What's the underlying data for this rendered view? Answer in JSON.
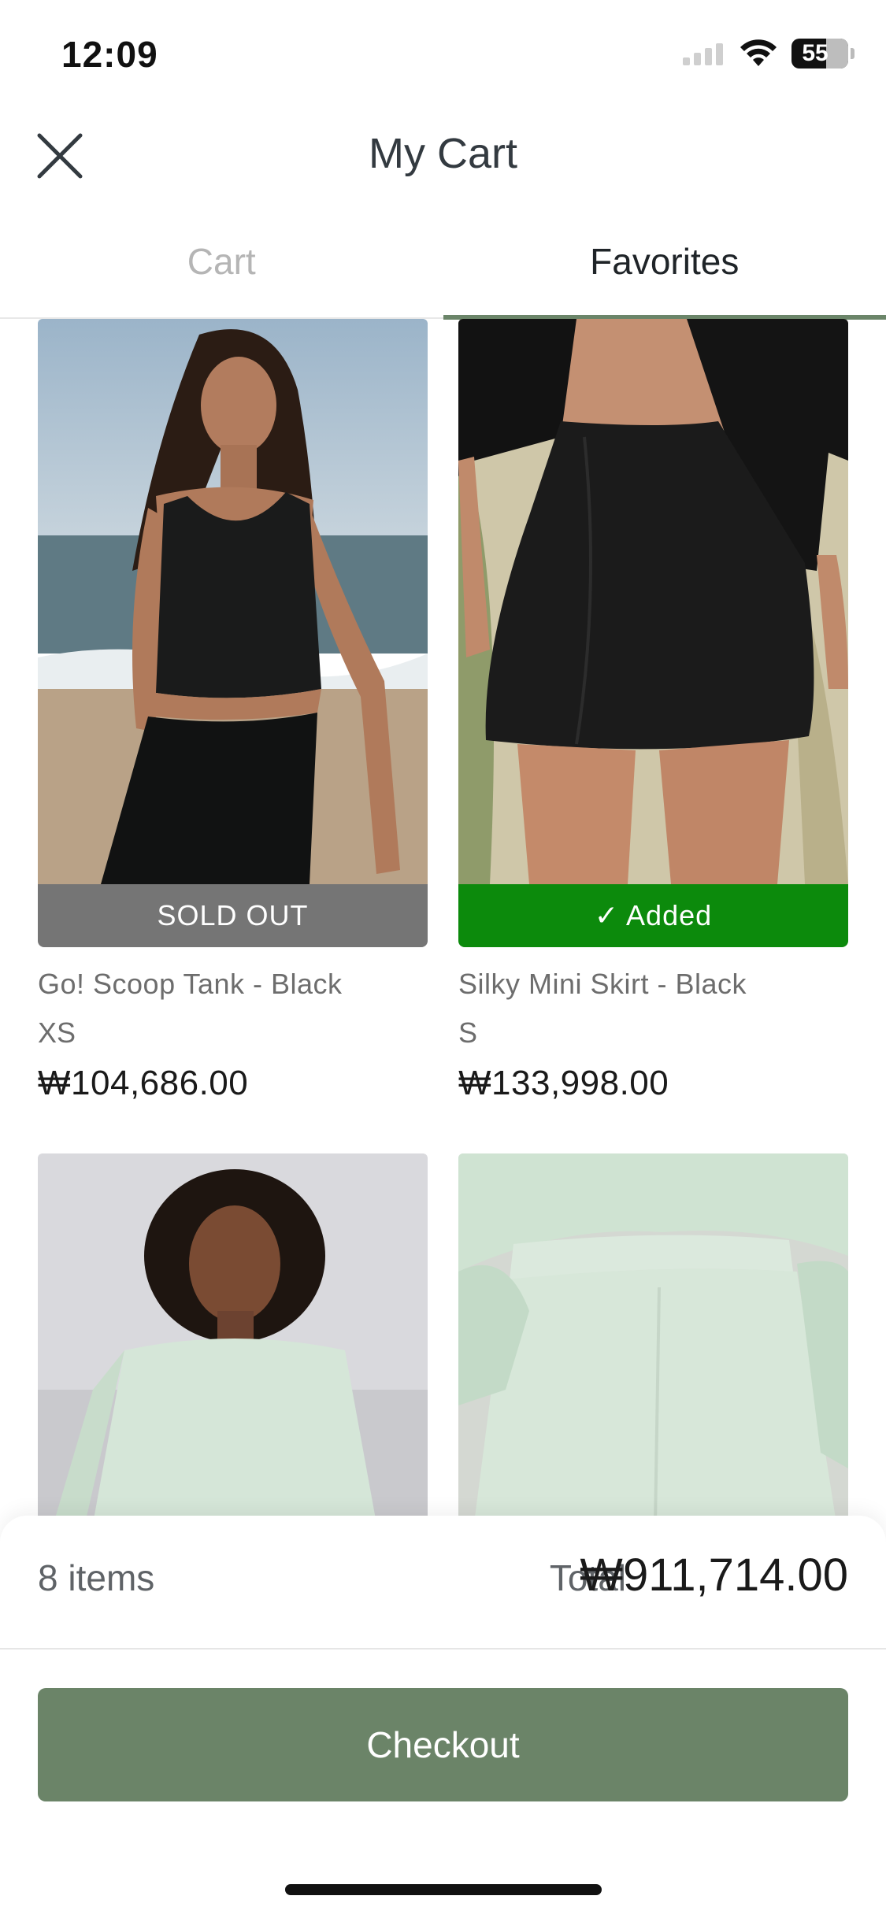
{
  "status_bar": {
    "time": "12:09",
    "battery": "55"
  },
  "header": {
    "title": "My Cart",
    "close_icon": "close-icon"
  },
  "tabs": [
    {
      "label": "Cart",
      "active": false
    },
    {
      "label": "Favorites",
      "active": true
    }
  ],
  "products": [
    {
      "name": "Go! Scoop Tank - Black",
      "size": "XS",
      "price": "₩104,686.00",
      "banner": "SOLD OUT",
      "banner_color": "#757575"
    },
    {
      "name": "Silky Mini Skirt - Black",
      "size": "S",
      "price": "₩133,998.00",
      "banner": "✓ Added",
      "banner_color": "#0c8a0c"
    },
    {
      "name": "",
      "size": "",
      "price": "",
      "banner": ""
    },
    {
      "name": "",
      "size": "",
      "price": "",
      "banner": ""
    }
  ],
  "summary": {
    "items_count": "8 items",
    "total_label": "Total",
    "total_value": "₩911,714.00"
  },
  "checkout": {
    "label": "Checkout",
    "color": "#6b8468"
  },
  "colors": {
    "accent": "#6b8569",
    "sold_out": "#757575",
    "added": "#0c8a0c"
  }
}
